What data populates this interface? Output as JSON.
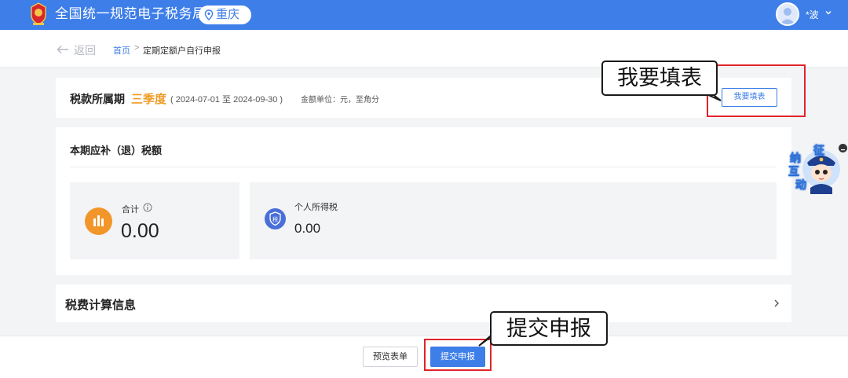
{
  "header": {
    "site_title": "全国统一规范电子税务局",
    "region": "重庆",
    "username": "*波",
    "colors": {
      "brand": "#3d7ee8"
    }
  },
  "breadcrumb": {
    "back_label": "返回",
    "home": "首页",
    "separator": ">",
    "current": "定期定额户自行申报"
  },
  "period": {
    "label": "税款所属期",
    "value": "三季度",
    "range": "( 2024-07-01 至 2024-09-30 )",
    "unit_note": "金额单位：元，至角分",
    "fill_button": "我要填表"
  },
  "amount": {
    "title": "本期应补（退）税额",
    "total_label": "合计",
    "total_value": "0.00",
    "tax_label": "个人所得税",
    "tax_value": "0.00",
    "tax_icon_char": "税"
  },
  "calc": {
    "title": "税费计算信息"
  },
  "footer": {
    "preview_button": "预览表单",
    "submit_button": "提交申报"
  },
  "annotations": {
    "fill_callout": "我要填表",
    "submit_callout": "提交申报"
  },
  "helper": {
    "chars": [
      "征",
      "纳",
      "互",
      "动"
    ]
  }
}
